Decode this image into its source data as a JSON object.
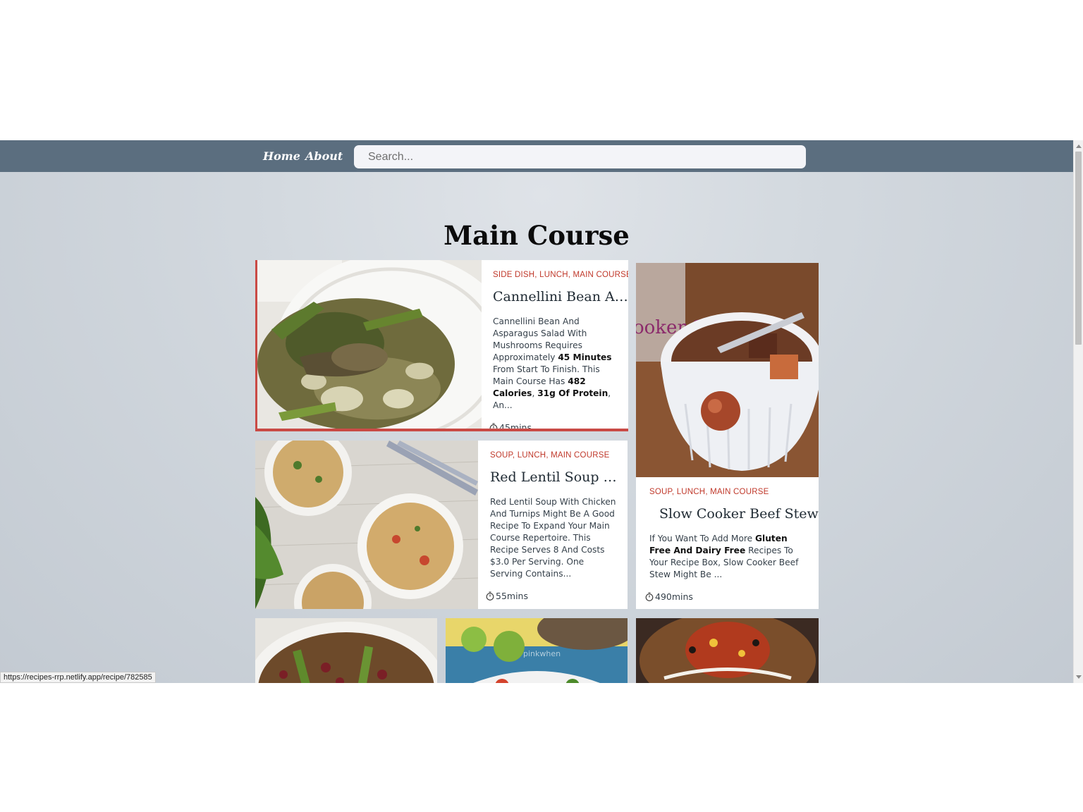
{
  "nav": {
    "home_label": "Home",
    "about_label": "About",
    "search_placeholder": "Search..."
  },
  "page": {
    "title": "Main Course"
  },
  "recipes": [
    {
      "tags": "SIDE DISH, LUNCH, MAIN COURSE",
      "title": "Cannellini Bean And...",
      "summary_parts": [
        "Cannellini Bean And Asparagus Salad With Mushrooms Requires Approximately ",
        "45 Minutes",
        " From Start To Finish. This Main Course Has ",
        "482 Calories",
        ", ",
        "31g Of Protein",
        ", An..."
      ],
      "time": "45mins"
    },
    {
      "tags": "SOUP, LUNCH, MAIN COURSE",
      "title": "Red Lentil Soup Wit...",
      "summary": "Red Lentil Soup With Chicken And Turnips Might Be A Good Recipe To Expand Your Main Course Repertoire. This Recipe Serves 8 And Costs $3.0 Per Serving. One Serving Contains...",
      "time": "55mins"
    },
    {
      "tags": "SOUP, LUNCH, MAIN COURSE",
      "title": "Slow Cooker Beef Stew",
      "summary_parts": [
        "If You Want To Add More ",
        "Gluten Free And Dairy Free",
        " Recipes To Your Recipe Box, Slow Cooker Beef Stew Might Be ..."
      ],
      "time": "490mins",
      "image_text": "ooker Stew"
    }
  ],
  "bottom_cards": [
    {
      "image_text": "pinkwhen"
    }
  ],
  "status_bar": {
    "url": "https://recipes-rrp.netlify.app/recipe/782585"
  },
  "colors": {
    "accent": "#c94a45",
    "navbar": "#5b6e7f",
    "tag": "#c0392b"
  }
}
